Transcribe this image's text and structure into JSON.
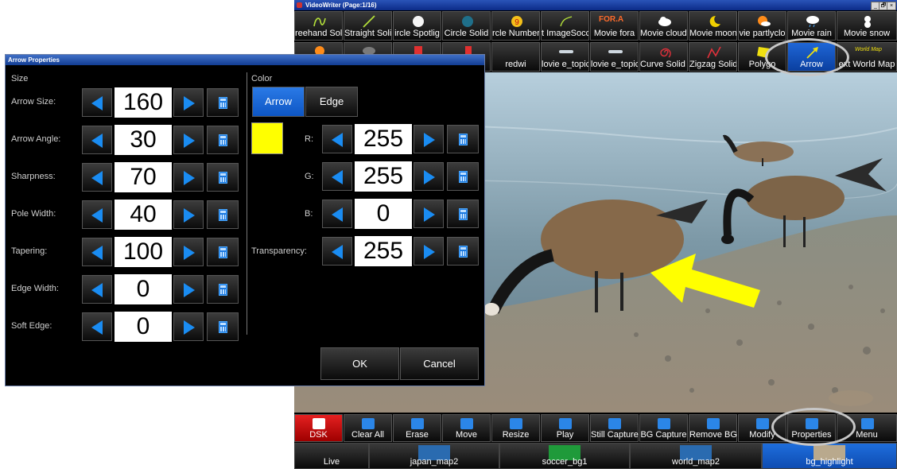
{
  "app": {
    "title": "VideoWriter (Page:1/16)",
    "window_controls": [
      "_",
      "🗗",
      "×"
    ]
  },
  "toolbar_row1": [
    "reehand Soli",
    "Straight Solid",
    "ircle Spotlig",
    "Circle Solid",
    "rcle Numberi",
    "t ImageSocc",
    "Movie fora",
    "Movie cloudy",
    "Movie moon",
    "vie partlyclo",
    "Movie rain",
    "Movie snow"
  ],
  "toolbar_row2": [
    "",
    "",
    "",
    "",
    "redwi",
    "lovie e_topic",
    "lovie e_topic",
    "Curve Solid w/",
    "Zigzag Solid",
    "Polygo",
    "Arrow",
    "ext World Map"
  ],
  "toolbar_row1_badges": {
    "fora": "FOR.A",
    "number": "9"
  },
  "toolbar_row2_badges": {
    "world_map": "World Map"
  },
  "bottom_toolbar": [
    "DSK",
    "Clear All",
    "Erase",
    "Move",
    "Resize",
    "Play",
    "Still Capture",
    "BG Capture",
    "Remove BG",
    "Modify",
    "Properties",
    "Menu"
  ],
  "bg_tabs": [
    "Live",
    "japan_map2",
    "soccer_bg1",
    "world_map2",
    "bg_highlight"
  ],
  "dialog": {
    "title": "Arrow Properties",
    "size_section": "Size",
    "color_section": "Color",
    "size_fields": [
      {
        "label": "Arrow Size:",
        "value": "160"
      },
      {
        "label": "Arrow Angle:",
        "value": "30"
      },
      {
        "label": "Sharpness:",
        "value": "70"
      },
      {
        "label": "Pole Width:",
        "value": "40"
      },
      {
        "label": "Tapering:",
        "value": "100"
      },
      {
        "label": "Edge Width:",
        "value": "0"
      },
      {
        "label": "Soft Edge:",
        "value": "0"
      }
    ],
    "color_tabs": {
      "arrow": "Arrow",
      "edge": "Edge"
    },
    "color_fields": [
      {
        "label": "R:",
        "value": "255"
      },
      {
        "label": "G:",
        "value": "255"
      },
      {
        "label": "B:",
        "value": "0"
      },
      {
        "label": "Transparency:",
        "value": "255"
      }
    ],
    "ok_label": "OK",
    "cancel_label": "Cancel",
    "swatch_color": "#ffff00"
  },
  "colors": {
    "accent_blue": "#1a8cf2",
    "selected_tab": "#0d56c4",
    "dsk_red": "#e52020",
    "arrow_yellow": "#ffff00"
  }
}
